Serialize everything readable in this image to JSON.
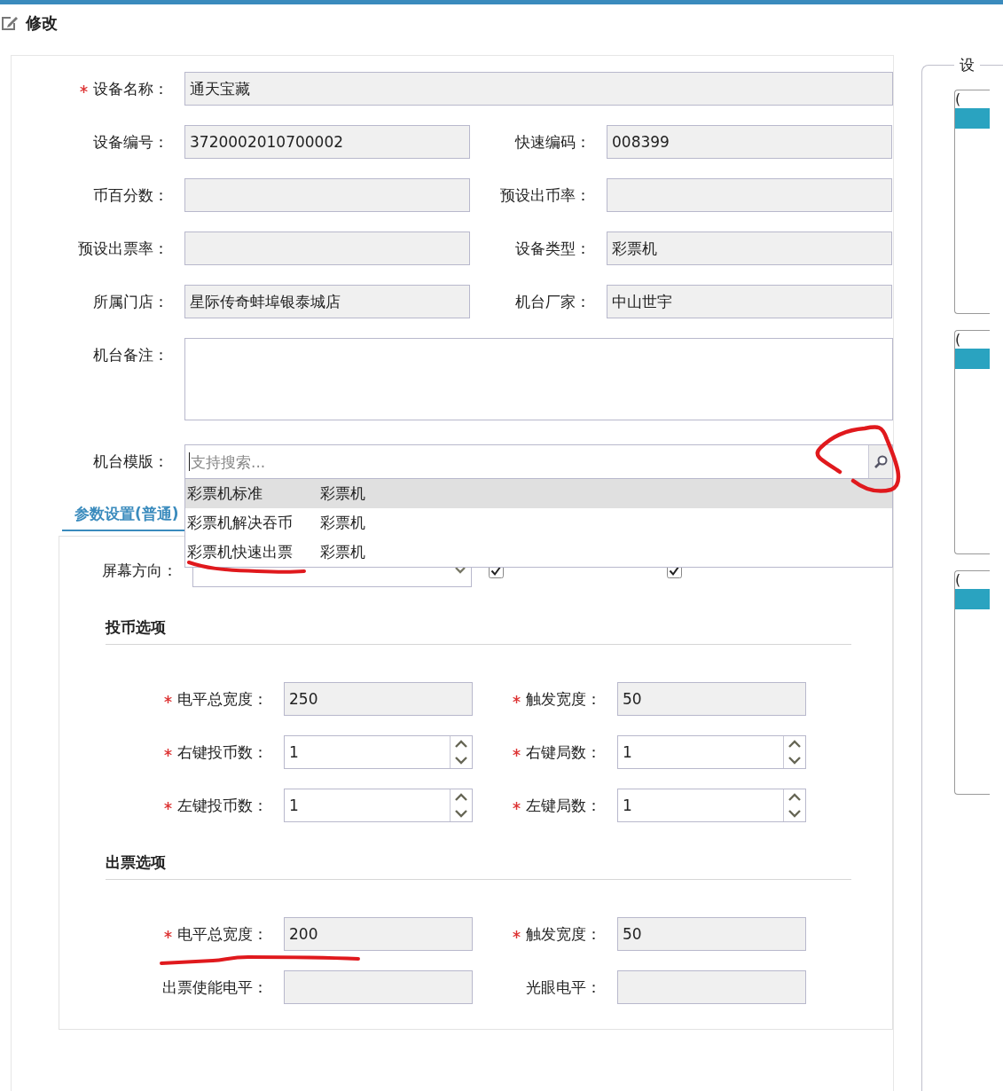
{
  "header": {
    "title": "修改"
  },
  "device_rows": [
    [
      {
        "label": "设备名称：",
        "value": "通天宝藏",
        "required": true,
        "readonly": true,
        "kind": "wide"
      }
    ],
    [
      {
        "label": "设备编号：",
        "value": "3720002010700002",
        "required": false,
        "readonly": true,
        "kind": "text"
      },
      {
        "label": "快速编码：",
        "value": "008399",
        "required": false,
        "readonly": true,
        "kind": "text"
      }
    ],
    [
      {
        "label": "币百分数：",
        "required": false,
        "readonly": true,
        "kind": "text"
      },
      {
        "label": "预设出币率：",
        "required": false,
        "readonly": true,
        "kind": "text"
      }
    ],
    [
      {
        "label": "预设出票率：",
        "required": false,
        "readonly": true,
        "kind": "text"
      },
      {
        "label": "设备类型：",
        "value": "彩票机",
        "required": false,
        "readonly": true,
        "kind": "text"
      }
    ],
    [
      {
        "label": "所属门店：",
        "value": "星际传奇蚌埠银泰城店",
        "required": false,
        "readonly": true,
        "kind": "text"
      },
      {
        "label": "机台厂家：",
        "value": "中山世宇",
        "required": false,
        "readonly": true,
        "kind": "text"
      }
    ],
    [
      {
        "label": "机台备注：",
        "required": false,
        "readonly": false,
        "kind": "textarea"
      }
    ]
  ],
  "template": {
    "label": "机台模版：",
    "placeholder": "支持搜索...",
    "options": [
      {
        "name": "彩票机标准",
        "type": "彩票机",
        "selected": true
      },
      {
        "name": "彩票机解决吞币",
        "type": "彩票机",
        "selected": false
      },
      {
        "name": "彩票机快速出票",
        "type": "彩票机",
        "selected": false
      }
    ]
  },
  "tabs": [
    {
      "label": "参数设置(普通)",
      "selected": true
    }
  ],
  "screen": {
    "label": "屏幕方向："
  },
  "checkboxes": [
    {
      "checked": true
    },
    {
      "checked": true
    }
  ],
  "sections": [
    {
      "title": "投币选项",
      "rows": [
        [
          {
            "label": "电平总宽度：",
            "value": "250",
            "required": true,
            "readonly": true,
            "kind": "text"
          },
          {
            "label": "触发宽度：",
            "value": "50",
            "required": true,
            "readonly": true,
            "kind": "text"
          }
        ],
        [
          {
            "label": "右键投币数：",
            "value": "1",
            "required": true,
            "readonly": false,
            "kind": "spinner"
          },
          {
            "label": "右键局数：",
            "value": "1",
            "required": true,
            "readonly": false,
            "kind": "spinner"
          }
        ],
        [
          {
            "label": "左键投币数：",
            "value": "1",
            "required": true,
            "readonly": false,
            "kind": "spinner"
          },
          {
            "label": "左键局数：",
            "value": "1",
            "required": true,
            "readonly": false,
            "kind": "spinner"
          }
        ]
      ]
    },
    {
      "title": "出票选项",
      "rows": [
        [
          {
            "label": "电平总宽度：",
            "value": "200",
            "required": true,
            "readonly": true,
            "kind": "text"
          },
          {
            "label": "触发宽度：",
            "value": "50",
            "required": true,
            "readonly": true,
            "kind": "text"
          }
        ],
        [
          {
            "label": "出票使能电平：",
            "required": false,
            "readonly": true,
            "kind": "text"
          },
          {
            "label": "光眼电平：",
            "required": false,
            "readonly": true,
            "kind": "text"
          }
        ]
      ]
    }
  ],
  "side_panel": {
    "legend": "设",
    "cards": [
      {
        "text": "("
      },
      {
        "text": "("
      },
      {
        "text": "("
      }
    ]
  }
}
